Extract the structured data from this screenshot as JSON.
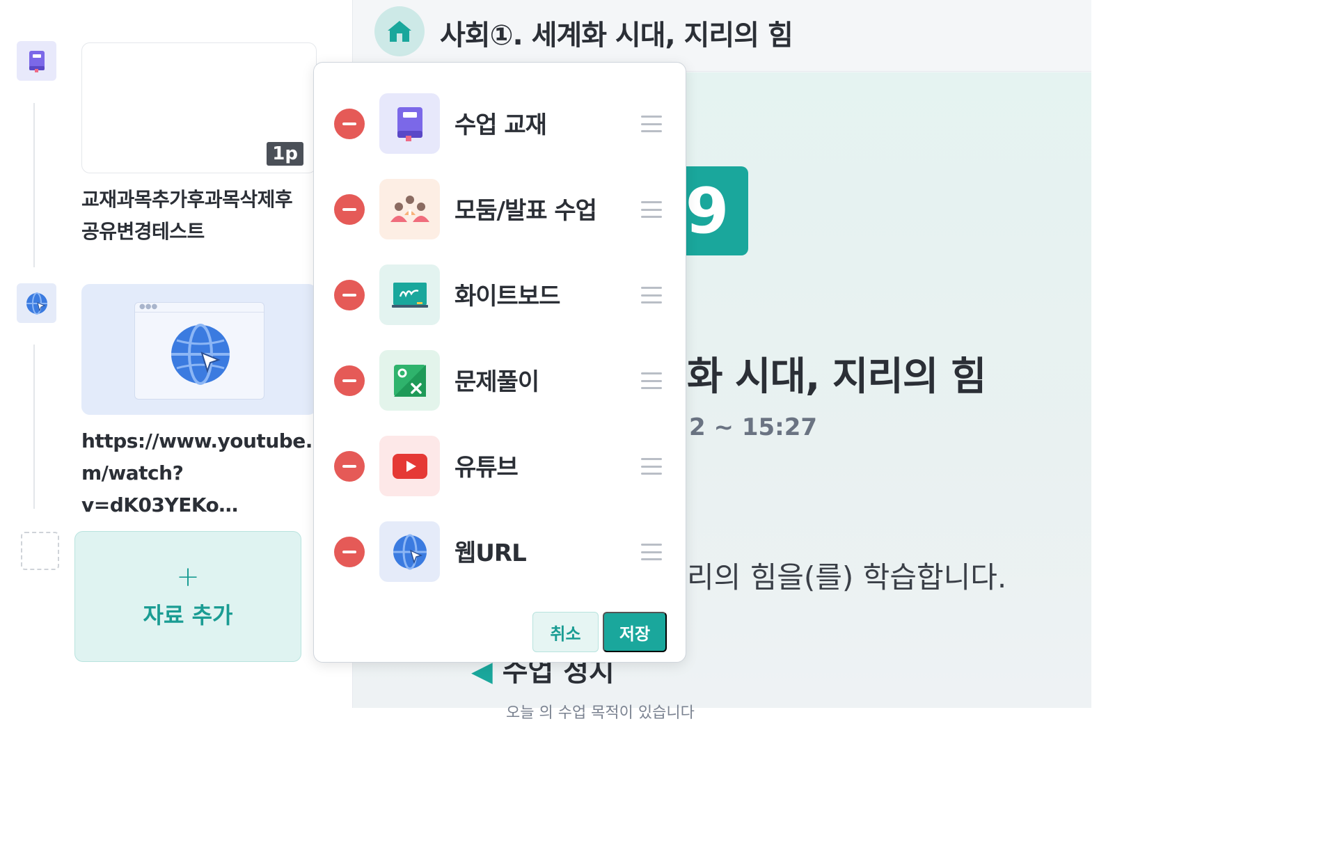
{
  "header": {
    "title": "사회①. 세계화 시대, 지리의 힘",
    "home_icon": "home-icon"
  },
  "left_panel": {
    "cards": [
      {
        "icon": "textbook-icon",
        "page_badge": "1p",
        "title_line1": "교재과목추가후과목삭제후",
        "title_line2": "공유변경테스트"
      },
      {
        "icon": "web-url-icon",
        "title_line1": "https://www.youtube.co",
        "title_line2": "m/watch?v=dK03YEKo…"
      }
    ],
    "add_button": {
      "plus": "+",
      "label": "자료 추가"
    }
  },
  "main": {
    "number_tile": "9",
    "big_title": "화 시대, 지리의 힘",
    "time": "2 ~ 15:27",
    "description": "리의 힘을(를) 학습합니다.",
    "section_peek": "수업 정지",
    "sub_peek": "오늘 의 수업 목적이 있습니다"
  },
  "popup": {
    "items": [
      {
        "label": "수업 교재",
        "icon": "textbook-icon",
        "bg": "#e7e8fb"
      },
      {
        "label": "모둠/발표 수업",
        "icon": "group-presentation-icon",
        "bg": "#fdeee4"
      },
      {
        "label": "화이트보드",
        "icon": "whiteboard-icon",
        "bg": "#e3f3f0"
      },
      {
        "label": "문제풀이",
        "icon": "problem-solving-icon",
        "bg": "#e3f4eb"
      },
      {
        "label": "유튜브",
        "icon": "youtube-icon",
        "bg": "#fde8e8"
      },
      {
        "label": "웹URL",
        "icon": "web-url-icon",
        "bg": "#e5ebf9"
      }
    ],
    "cancel_label": "취소",
    "save_label": "저장"
  },
  "colors": {
    "accent": "#1aa79c",
    "remove": "#e55a57"
  }
}
